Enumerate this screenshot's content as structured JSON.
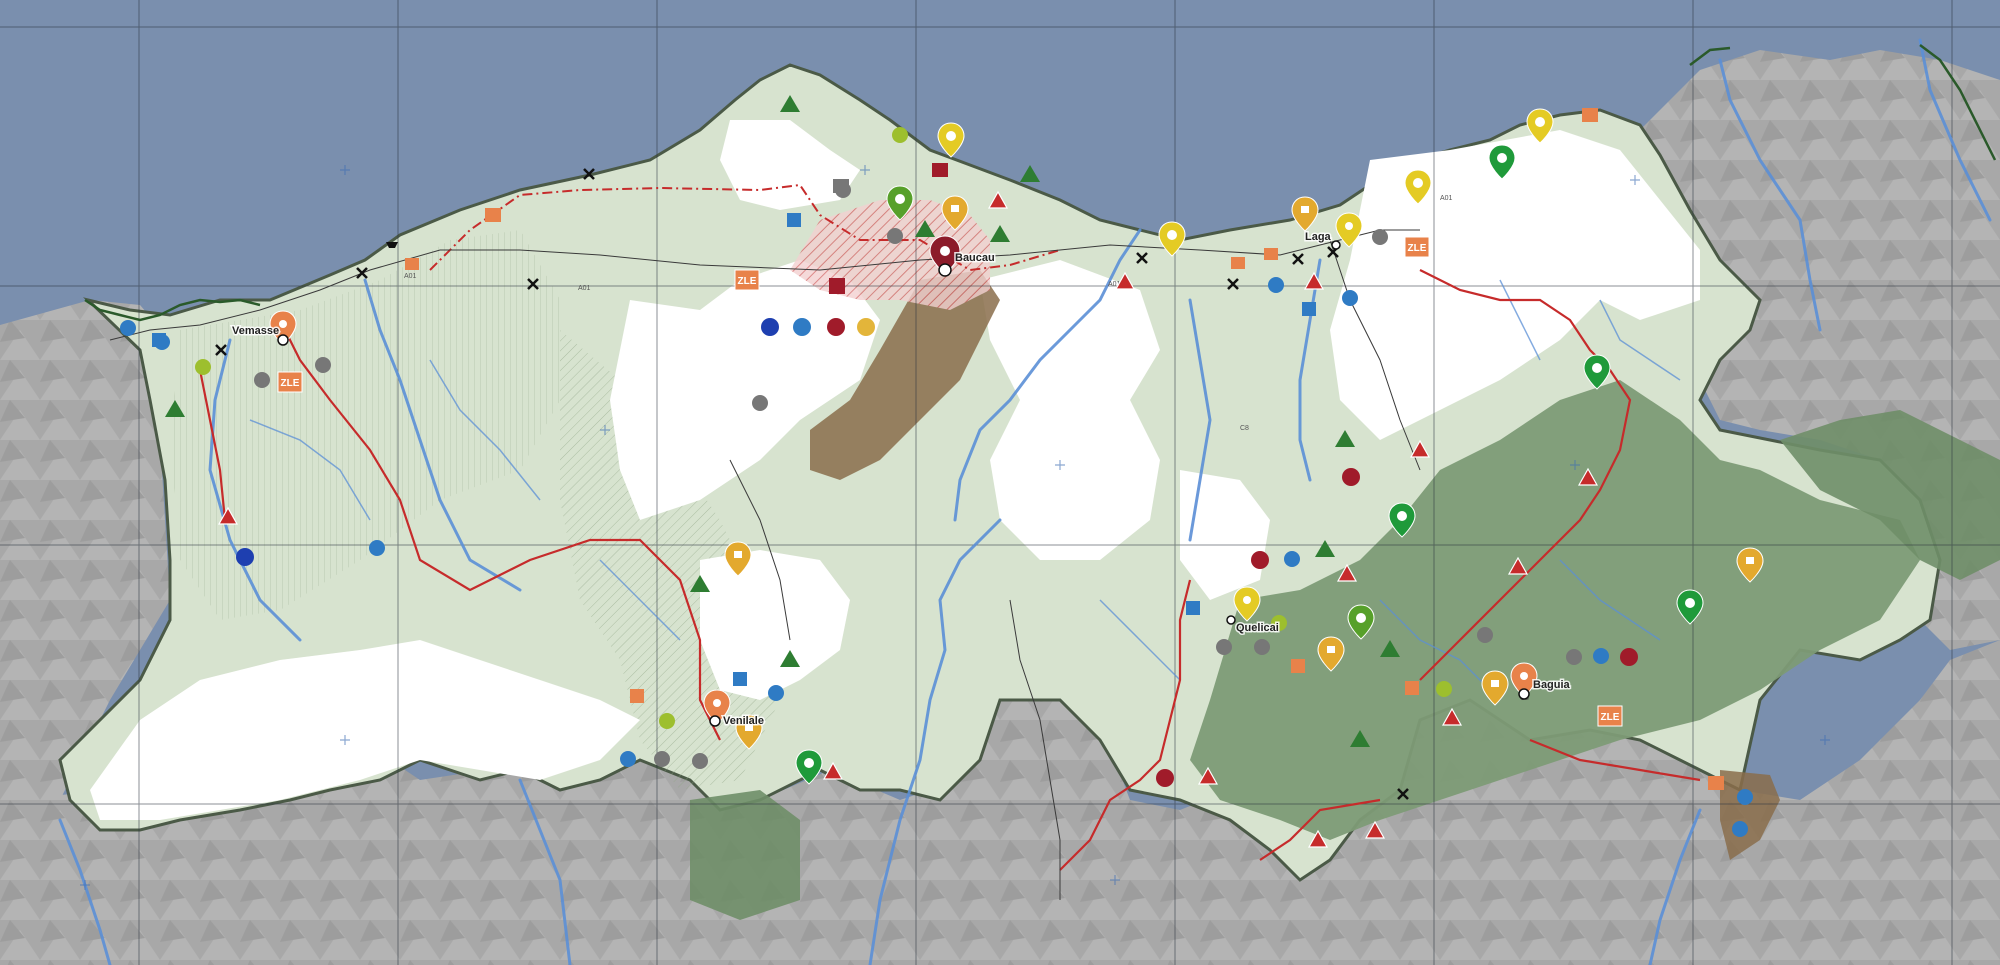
{
  "map": {
    "towns": [
      {
        "name": "Vemasse",
        "pin_color": "#e8824a"
      },
      {
        "name": "Baucau",
        "pin_color": "#8c1b2a"
      },
      {
        "name": "Laga",
        "pin_color": "#e4cb24"
      },
      {
        "name": "Quelicai",
        "pin_color": "#e4cb24"
      },
      {
        "name": "Venilale",
        "pin_color": "#e8824a"
      },
      {
        "name": "Baguia",
        "pin_color": "#e8824a"
      }
    ],
    "zle_label": "ZLE",
    "colors": {
      "sea": "#7a8fae",
      "outside_land": "#a9a9a9",
      "district_land": "#d7e3cf",
      "snow_white": "#ffffff",
      "forest_dark": "#7d9b76",
      "river": "#5b8fd6",
      "road_red": "#c62b2b",
      "boundary": "#4b5a47",
      "urban_brown": "#8a6d4b",
      "pink_zone": "#e8a8a8"
    },
    "icons": {
      "pin_yellow": "sun-pin-icon",
      "pin_green": "camera-pin-icon",
      "pin_orange": "town-pin-icon",
      "church": "church-icon",
      "hospital": "hospital-cross-icon",
      "bus": "bus-icon",
      "port": "port-icon",
      "water": "water-drop-icon",
      "warning": "warning-triangle-icon",
      "tree": "tree-icon",
      "airport": "airstrip-icon",
      "ship": "boat-icon"
    }
  }
}
